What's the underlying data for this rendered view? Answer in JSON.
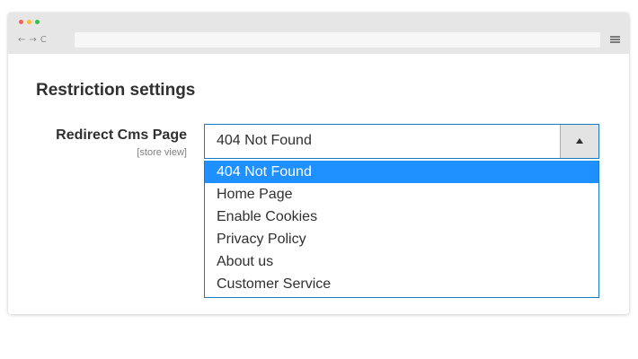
{
  "browser": {
    "nav_back": "←",
    "nav_forward": "→",
    "nav_reload": "C",
    "menu_icon": "hamburger-menu-icon",
    "traffic_light_colors": [
      "#ff5f57",
      "#ffbd2e",
      "#28c840"
    ]
  },
  "section": {
    "title": "Restriction settings"
  },
  "field": {
    "label": "Redirect Cms Page",
    "scope": "[store view]",
    "selected_value": "404 Not Found",
    "toggle_icon": "caret-up-icon",
    "options": [
      {
        "label": "404 Not Found",
        "selected": true
      },
      {
        "label": "Home Page",
        "selected": false
      },
      {
        "label": "Enable Cookies",
        "selected": false
      },
      {
        "label": "Privacy Policy",
        "selected": false
      },
      {
        "label": "About us",
        "selected": false
      },
      {
        "label": "Customer Service",
        "selected": false
      }
    ]
  },
  "colors": {
    "accent_border": "#1979c3",
    "selected_option_bg": "#1e90ff",
    "text": "#303030"
  }
}
